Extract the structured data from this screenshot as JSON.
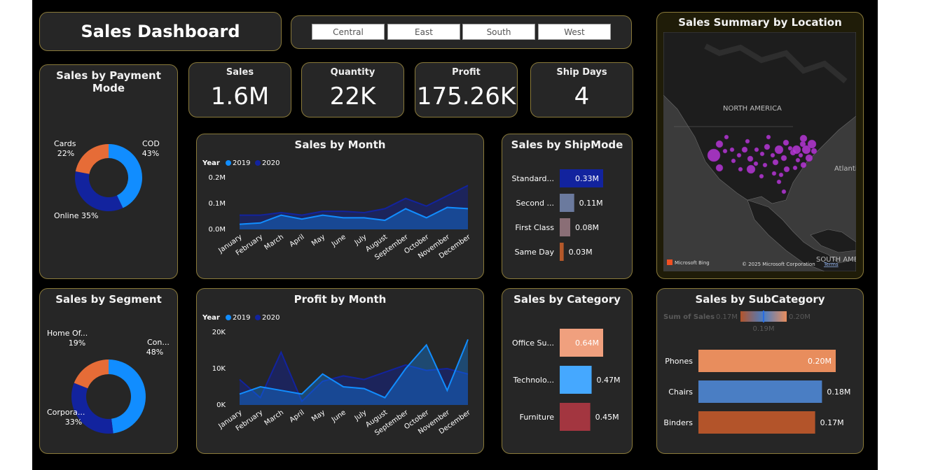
{
  "header": {
    "title": "Sales Dashboard"
  },
  "region_slicer": {
    "options": [
      "Central",
      "East",
      "South",
      "West"
    ]
  },
  "kpis": [
    {
      "label": "Sales",
      "value": "1.6M"
    },
    {
      "label": "Quantity",
      "value": "22K"
    },
    {
      "label": "Profit",
      "value": "175.26K"
    },
    {
      "label": "Ship Days",
      "value": "4"
    }
  ],
  "colors": {
    "c2019": "#118dff",
    "c2020": "#12239e",
    "orange": "#e66c37",
    "panel": "#262626",
    "border": "#8a7a3a"
  },
  "map": {
    "title": "Sales Summary by Location",
    "labels": {
      "na": "NORTH AMERICA",
      "atlantic": "Atlanti",
      "sa": "SOUTH AME"
    },
    "attribution": {
      "brand": "Microsoft Bing",
      "copyright": "© 2025 Microsoft Corporation",
      "terms": "Terms"
    }
  },
  "chart_data": [
    {
      "type": "pie",
      "title": "Sales by Payment Mode",
      "slices": [
        {
          "label": "COD",
          "value": 43,
          "display": "43%",
          "color": "#118dff"
        },
        {
          "label": "Online",
          "value": 35,
          "display": "35%",
          "color": "#12239e"
        },
        {
          "label": "Cards",
          "value": 22,
          "display": "22%",
          "color": "#e66c37"
        }
      ]
    },
    {
      "type": "pie",
      "title": "Sales by Segment",
      "slices": [
        {
          "label": "Con...",
          "value": 48,
          "display": "48%",
          "color": "#118dff"
        },
        {
          "label": "Corpora...",
          "value": 33,
          "display": "33%",
          "color": "#12239e"
        },
        {
          "label": "Home Of...",
          "value": 19,
          "display": "19%",
          "color": "#e66c37"
        }
      ]
    },
    {
      "type": "area",
      "title": "Sales by Month",
      "legend_title": "Year",
      "categories": [
        "January",
        "February",
        "March",
        "April",
        "May",
        "June",
        "July",
        "August",
        "September",
        "October",
        "November",
        "December"
      ],
      "series": [
        {
          "name": "2019",
          "values": [
            0.02,
            0.025,
            0.055,
            0.04,
            0.055,
            0.045,
            0.045,
            0.035,
            0.08,
            0.045,
            0.085,
            0.08
          ]
        },
        {
          "name": "2020",
          "values": [
            0.055,
            0.055,
            0.065,
            0.055,
            0.07,
            0.07,
            0.065,
            0.08,
            0.12,
            0.09,
            0.13,
            0.17
          ]
        }
      ],
      "yticks": [
        0,
        0.1,
        0.2
      ],
      "ytick_labels": [
        "0.0M",
        "0.1M",
        "0.2M"
      ],
      "ylim": [
        0,
        0.2
      ]
    },
    {
      "type": "area",
      "title": "Profit by Month",
      "legend_title": "Year",
      "categories": [
        "January",
        "February",
        "March",
        "April",
        "May",
        "June",
        "July",
        "August",
        "September",
        "October",
        "November",
        "December"
      ],
      "series": [
        {
          "name": "2019",
          "values": [
            3000,
            5000,
            4000,
            3000,
            8500,
            5000,
            4500,
            2000,
            10000,
            16500,
            4000,
            18000
          ]
        },
        {
          "name": "2020",
          "values": [
            7000,
            2000,
            14500,
            1000,
            6500,
            8000,
            7000,
            9000,
            11000,
            9500,
            10000,
            8500
          ]
        }
      ],
      "yticks": [
        0,
        10000,
        20000
      ],
      "ytick_labels": [
        "0K",
        "10K",
        "20K"
      ],
      "ylim": [
        0,
        20000
      ]
    },
    {
      "type": "bar",
      "title": "Sales by ShipMode",
      "categories": [
        "Standard...",
        "Second ...",
        "First Class",
        "Same Day"
      ],
      "values": [
        0.33,
        0.11,
        0.08,
        0.03
      ],
      "labels": [
        "0.33M",
        "0.11M",
        "0.08M",
        "0.03M"
      ],
      "colors": [
        "#12239e",
        "#6b7a9e",
        "#8a6e76",
        "#b4582a"
      ]
    },
    {
      "type": "bar",
      "title": "Sales by Category",
      "categories": [
        "Office Su...",
        "Technolo...",
        "Furniture"
      ],
      "values": [
        0.64,
        0.47,
        0.45
      ],
      "labels": [
        "0.64M",
        "0.47M",
        "0.45M"
      ],
      "colors": [
        "#f0a07e",
        "#45a8ff",
        "#a33640"
      ]
    },
    {
      "type": "bar",
      "title": "Sales by SubCategory",
      "legend": {
        "title": "Sum of Sales",
        "min": "0.17M",
        "mid": "0.19M",
        "max": "0.20M"
      },
      "categories": [
        "Phones",
        "Chairs",
        "Binders"
      ],
      "values": [
        0.2,
        0.18,
        0.17
      ],
      "labels": [
        "0.20M",
        "0.18M",
        "0.17M"
      ],
      "colors": [
        "#e88d5d",
        "#4a7ec4",
        "#b3542a"
      ]
    }
  ]
}
